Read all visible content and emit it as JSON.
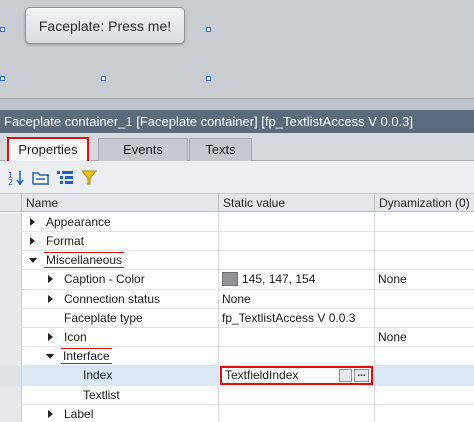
{
  "canvas": {
    "faceplate_button_label": "Faceplate: Press me!"
  },
  "title_bar": {
    "text": "Faceplate container_1 [Faceplate container] [fp_TextlistAccess V 0.0.3]"
  },
  "tabs": [
    {
      "label": "Properties",
      "active": true
    },
    {
      "label": "Events",
      "active": false
    },
    {
      "label": "Texts",
      "active": false
    }
  ],
  "toolbar": {
    "icons": [
      "sort-icon",
      "folder-icon",
      "list-icon",
      "filter-icon"
    ]
  },
  "grid": {
    "columns": [
      "Name",
      "Static value",
      "Dynamization (0)"
    ],
    "rows": [
      {
        "name": "Appearance",
        "static_value": "",
        "dynamization": ""
      },
      {
        "name": "Format",
        "static_value": "",
        "dynamization": ""
      },
      {
        "name": "Miscellaneous",
        "static_value": "",
        "dynamization": ""
      },
      {
        "name": "Caption - Color",
        "static_value": "145, 147, 154",
        "dynamization": "None"
      },
      {
        "name": "Connection status",
        "static_value": "None",
        "dynamization": ""
      },
      {
        "name": "Faceplate type",
        "static_value": "fp_TextlistAccess V 0.0.3",
        "dynamization": ""
      },
      {
        "name": "Icon",
        "static_value": "",
        "dynamization": "None"
      },
      {
        "name": "Interface",
        "static_value": "",
        "dynamization": ""
      },
      {
        "name": "Index",
        "static_value": "TextfieldIndex",
        "dynamization": ""
      },
      {
        "name": "Textlist",
        "static_value": "",
        "dynamization": ""
      },
      {
        "name": "Label",
        "static_value": "",
        "dynamization": ""
      }
    ]
  },
  "colors": {
    "caption_color": "#919399",
    "highlight": "#e01010",
    "title_bar": "#5a6b7e"
  }
}
